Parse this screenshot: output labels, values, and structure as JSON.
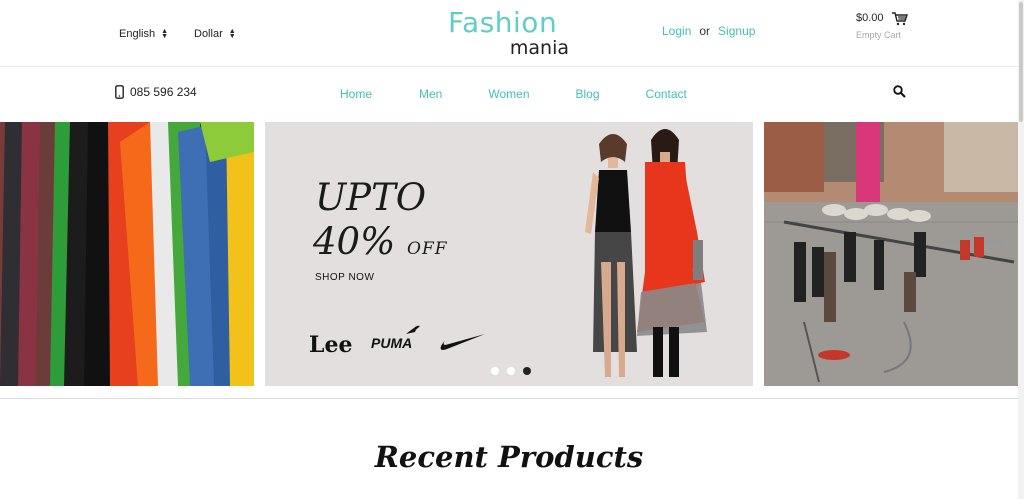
{
  "header": {
    "language": "English",
    "currency": "Dollar",
    "logo_line1": "Fashion",
    "logo_line2": "mania",
    "login": "Login",
    "or": "or",
    "signup": "Signup",
    "cart_amount": "$0.00",
    "cart_status": "Empty Cart"
  },
  "nav": {
    "phone": "085 596 234",
    "items": [
      "Home",
      "Men",
      "Women",
      "Blog",
      "Contact"
    ]
  },
  "promo": {
    "line1": "UPTO",
    "line2": "40%",
    "line2b": "OFF",
    "cta": "SHOP NOW",
    "brands": [
      "Lee",
      "PUMA"
    ],
    "active_slide": 3,
    "slide_count": 3
  },
  "section": {
    "title": "Recent Products"
  },
  "colors": {
    "accent": "#44bfb4",
    "logo": "#5fcfc5",
    "banner_bg": "#e3dfdf"
  }
}
